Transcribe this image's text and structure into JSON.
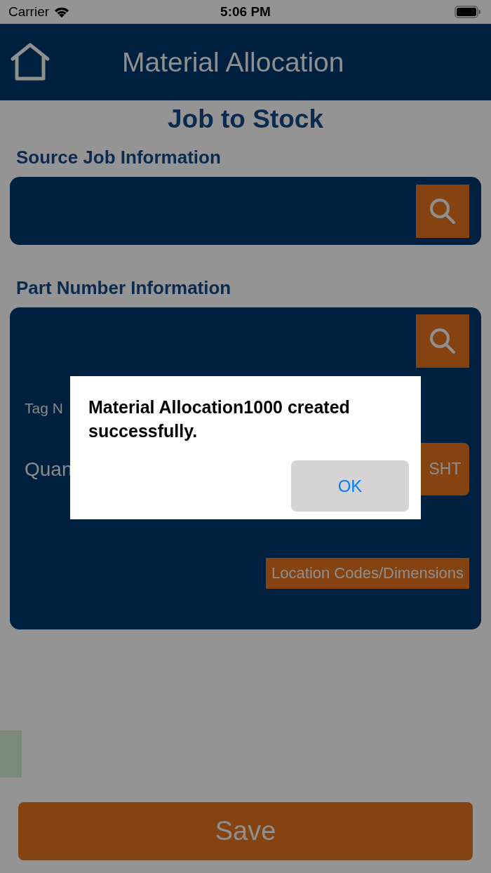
{
  "status_bar": {
    "carrier": "Carrier",
    "time": "5:06 PM"
  },
  "header": {
    "title": "Material Allocation"
  },
  "page_title": "Job to Stock",
  "source_job": {
    "label": "Source Job Information"
  },
  "part_number": {
    "label": "Part Number Information",
    "tag_label": "Tag N",
    "quantity_label": "Quan",
    "unit_button": "SHT",
    "location_button": "Location Codes/Dimensions"
  },
  "save_button": "Save",
  "dialog": {
    "message": "Material Allocation1000 created successfully.",
    "ok_button": "OK"
  }
}
